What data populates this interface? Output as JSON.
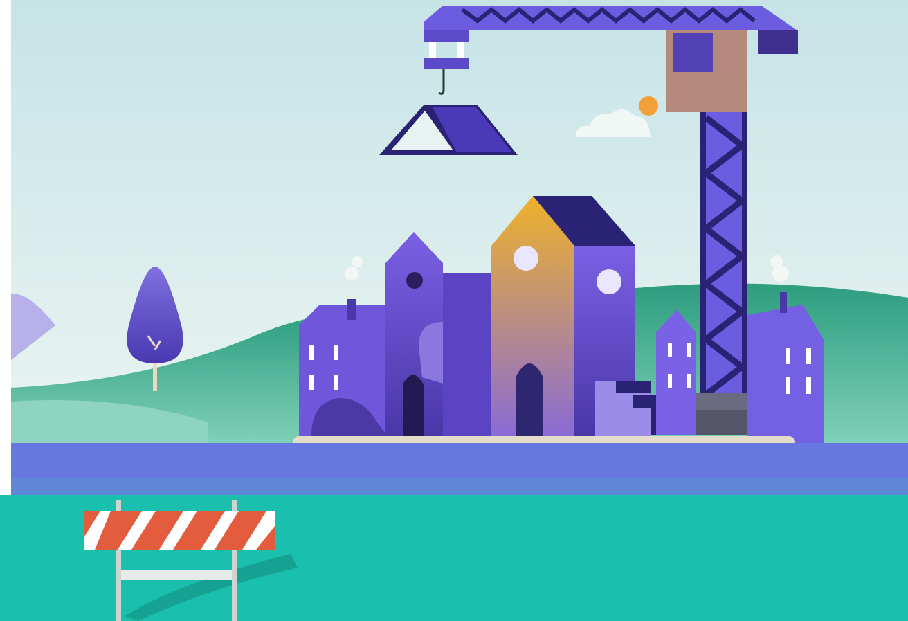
{
  "scene": {
    "description_name": "construction-illustration",
    "colors": {
      "sky_top": "#c6e3e6",
      "sky_bottom": "#e7f3f0",
      "hill_green": "#2d9d7e",
      "hill_light": "#8fd3c1",
      "water_blue": "#6677e0",
      "ground_teal": "#1abfae",
      "house_purple": "#6f56db",
      "house_dark": "#3d2f8f",
      "house_gold": "#e7ad2f",
      "crane_purple": "#6c5ce0",
      "crane_dark": "#2a2275",
      "barrier_orange": "#e45c3e",
      "sidewalk": "#e5ddcc",
      "sun_orange": "#f2a03a"
    },
    "icons": [
      "crane-icon",
      "houses-icon",
      "tree-icon",
      "barrier-icon",
      "sun-icon",
      "cloud-icon",
      "roof-piece-icon"
    ]
  }
}
